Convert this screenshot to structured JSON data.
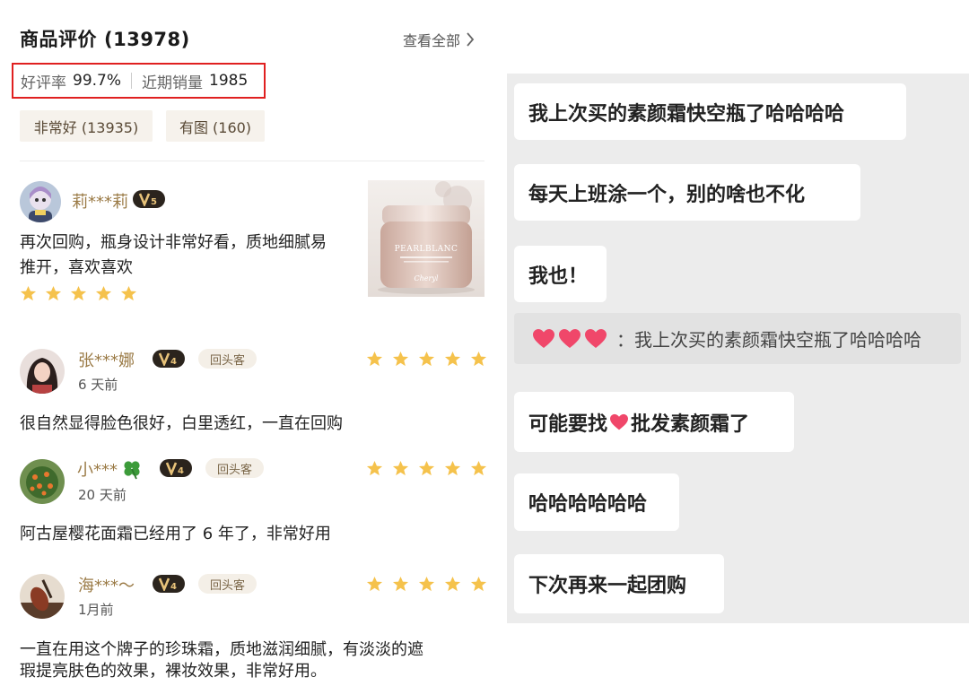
{
  "header": {
    "title": "商品评价",
    "count": "(13978)",
    "view_all": "查看全部"
  },
  "stats": {
    "good_rate_label": "好评率",
    "good_rate_value": "99.7%",
    "recent_sales_label": "近期销量",
    "recent_sales_value": "1985"
  },
  "filters": [
    "非常好 (13935)",
    "有图 (160)"
  ],
  "reviews": [
    {
      "username": "莉***莉",
      "level": "5",
      "text_line1": "再次回购，瓶身设计非常好看，质地细腻易",
      "text_line2": "推开，喜欢喜欢",
      "stars": 5,
      "product_image": {
        "brand": "PEARLBLANC",
        "signature": "Cheryl"
      }
    },
    {
      "username": "张***娜",
      "level": "4",
      "badge": "回头客",
      "time": "6 天前",
      "text": "很自然显得脸色很好，白里透红，一直在回购",
      "stars": 5
    },
    {
      "username": "小***",
      "level": "4",
      "badge": "回头客",
      "time": "20 天前",
      "text": "阿古屋樱花面霜已经用了 6 年了，非常好用",
      "stars": 5
    },
    {
      "username": "海***～",
      "level": "4",
      "badge": "回头客",
      "time": "1月前",
      "text_line1": "一直在用这个牌子的珍珠霜，质地滋润细腻，有淡淡的遮",
      "text_line2": "瑕提亮肤色的效果，裸妆效果，非常好用。",
      "stars": 5
    }
  ],
  "chat": {
    "messages": [
      "我上次买的素颜霜快空瓶了哈哈哈哈",
      "每天上班涂一个，别的啥也不化",
      "我也！"
    ],
    "quote": "：我上次买的素颜霜快空瓶了哈哈哈哈",
    "msg_find_part1": "可能要找",
    "msg_find_part2": "批发素颜霜了",
    "messages2": [
      "哈哈哈哈哈哈",
      "下次再来一起团购"
    ]
  },
  "colors": {
    "highlight_border": "#e02020",
    "username": "#9a7a45",
    "star": "#f5c24c",
    "heart": "#f0476a",
    "chat_bg": "#ececec"
  }
}
